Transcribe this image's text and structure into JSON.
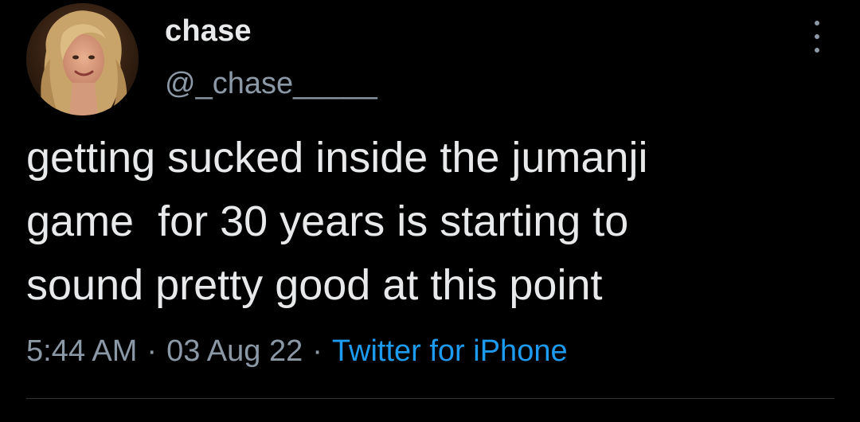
{
  "author": {
    "display_name": "chase",
    "handle": "@_chase_____",
    "avatar_icon": "profile-photo"
  },
  "tweet": {
    "text": "getting sucked inside the jumanji\ngame  for 30 years is starting to\nsound pretty good at this point"
  },
  "meta": {
    "time": "5:44 AM",
    "date": "03 Aug 22",
    "separator": "·",
    "source": "Twitter for iPhone"
  },
  "menu": {
    "icon": "more-vertical-icon"
  },
  "colors": {
    "background": "#000000",
    "primary_text": "#e7e9ea",
    "secondary_text": "#8b98a5",
    "link": "#1d9bf0",
    "divider": "#2f3336"
  }
}
